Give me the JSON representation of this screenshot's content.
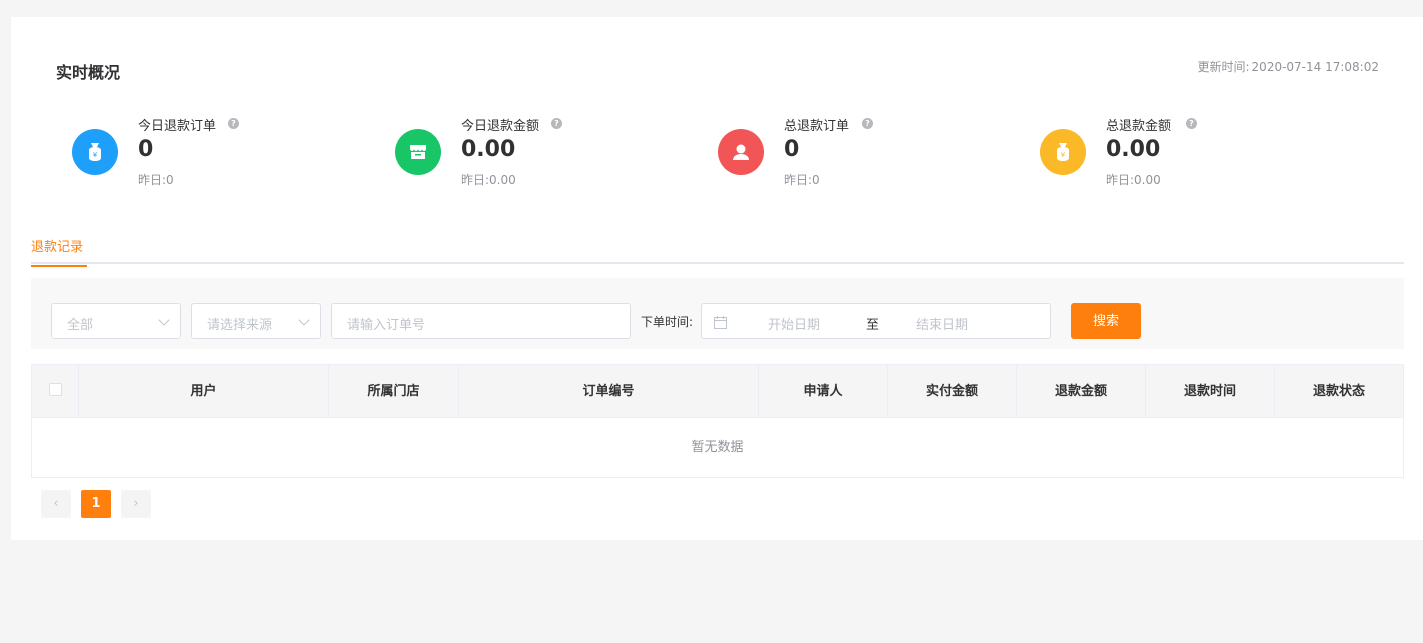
{
  "overview": {
    "title": "实时概况",
    "update_label": "更新时间:",
    "update_time": "2020-07-14 17:08:02"
  },
  "stats": [
    {
      "label": "今日退款订单",
      "value": "0",
      "yesterday": "昨日:0",
      "color": "#1ea0fa",
      "icon": "money-bag-icon"
    },
    {
      "label": "今日退款金额",
      "value": "0.00",
      "yesterday": "昨日:0.00",
      "color": "#19c667",
      "icon": "store-icon"
    },
    {
      "label": "总退款订单",
      "value": "0",
      "yesterday": "昨日:0",
      "color": "#f25555",
      "icon": "user-icon"
    },
    {
      "label": "总退款金额",
      "value": "0.00",
      "yesterday": "昨日:0.00",
      "color": "#fbb927",
      "icon": "money-bag-icon"
    }
  ],
  "tabs": [
    {
      "label": "退款记录"
    }
  ],
  "filters": {
    "status_select": "全部",
    "source_select": "请选择来源",
    "order_input_placeholder": "请输入订单号",
    "date_label": "下单时间:",
    "start_date": "开始日期",
    "separator": "至",
    "end_date": "结束日期",
    "search_button": "搜索"
  },
  "table": {
    "columns": [
      "用户",
      "所属门店",
      "订单编号",
      "申请人",
      "实付金额",
      "退款金额",
      "退款时间",
      "退款状态"
    ],
    "empty_text": "暂无数据"
  },
  "pagination": {
    "current": "1",
    "prev": "‹",
    "next": "›"
  },
  "colors": {
    "accent": "#ff7f0e"
  }
}
